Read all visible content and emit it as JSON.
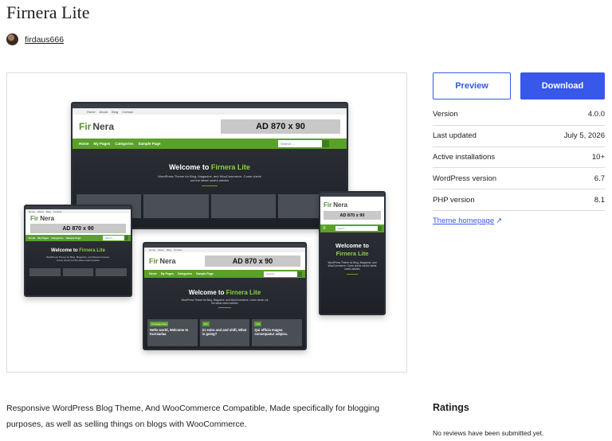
{
  "theme": {
    "title": "Firnera Lite",
    "author": "firdaus666"
  },
  "preview": {
    "logo_fir": "Fir",
    "logo_nera": "Nera",
    "ad_label": "AD 870 x 90",
    "nav_items": [
      "Home",
      "My Pages",
      "Categories",
      "Sample Page"
    ],
    "top_links": [
      "Home",
      "About",
      "Blog",
      "Contact"
    ],
    "search_placeholder": "Search ...",
    "hero_prefix": "Welcome to ",
    "hero_accent": "Firnera Lite",
    "hero_sub": "WordPress Theme for Blog, Magazine, and WooCommerce. Come check out the latest useful articles",
    "cards": [
      {
        "tag": "Uncategorized",
        "title": "Hello world, Welcome to Kurniadaa"
      },
      {
        "tag": "Info",
        "title": "21 extra and and shift, What is going?"
      },
      {
        "tag": "Info",
        "title": "Qui officia magna consequatur adipisc."
      }
    ],
    "colors": {
      "green": "#5aa12b",
      "dark": "#1c1f24",
      "accent": "#8bd043"
    }
  },
  "actions": {
    "preview_label": "Preview",
    "download_label": "Download",
    "accent_color": "#3858e9"
  },
  "meta": [
    {
      "key": "Version",
      "value": "4.0.0"
    },
    {
      "key": "Last updated",
      "value": "July 5, 2026"
    },
    {
      "key": "Active installations",
      "value": "10+"
    },
    {
      "key": "WordPress version",
      "value": "6.7"
    },
    {
      "key": "PHP version",
      "value": "8.1"
    }
  ],
  "homepage_label": "Theme homepage",
  "description": "Responsive WordPress Blog Theme, And WooCommerce Compatible, Made specifically for blogging purposes, as well as selling things on blogs with WooCommerce.",
  "ratings": {
    "heading": "Ratings",
    "empty": "No reviews have been submitted yet."
  }
}
